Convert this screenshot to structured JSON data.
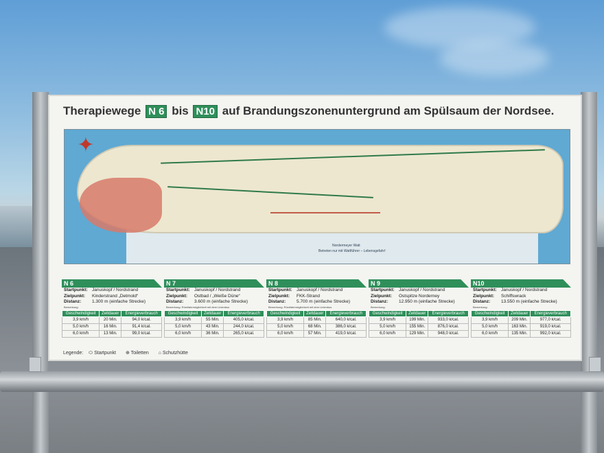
{
  "sign": {
    "title_before": "Therapiewege",
    "tag_start": "N 6",
    "title_mid": "bis",
    "tag_end": "N10",
    "title_after": "auf Brandungszonenuntergrund am Spülsaum der Nordsee."
  },
  "map": {
    "labels": [
      "Nordermeyer Watt",
      "Betreten nur mit Wattführer – Lebensgefahr!"
    ]
  },
  "table_headers": [
    "Geschwindigkeit",
    "Zeitdauer",
    "Energieverbrauch"
  ],
  "field_labels": {
    "start": "Startpunkt:",
    "goal": "Zielpunkt:",
    "distance": "Distanz:",
    "remark": "Bemerkung:"
  },
  "routes": [
    {
      "id": "N 6",
      "start": "Januskopf / Nordstrand",
      "goal": "Kinderstrand „Detmold“",
      "distance": "1.300 m (einfache Strecke)",
      "remark": "Bemerkung:",
      "rows": [
        [
          "3,9 km/h",
          "20 Min.",
          "94,0 k/cal."
        ],
        [
          "5,0 km/h",
          "16 Min.",
          "91,4 k/cal."
        ],
        [
          "6,0 km/h",
          "13 Min.",
          "99,0 k/cal."
        ]
      ]
    },
    {
      "id": "N 7",
      "start": "Januskopf / Nordstrand",
      "goal": "Ostbad / „Weiße Düne“",
      "distance": "3.600 m (einfache Strecke)",
      "remark": "Bemerkung: Rückfahrmöglichkeit mit dem Linienbus",
      "rows": [
        [
          "3,9 km/h",
          "55 Min.",
          "405,0 k/cal."
        ],
        [
          "5,0 km/h",
          "43 Min.",
          "244,0 k/cal."
        ],
        [
          "6,0 km/h",
          "36 Min.",
          "265,0 k/cal."
        ]
      ]
    },
    {
      "id": "N 8",
      "start": "Januskopf / Nordstrand",
      "goal": "FKK-Strand",
      "distance": "5.700 m (einfache Strecke)",
      "remark": "Bemerkung: Rückfahrmöglichkeit mit dem Linienbus",
      "rows": [
        [
          "3,9 km/h",
          "85 Min.",
          "640,0 k/cal."
        ],
        [
          "5,0 km/h",
          "68 Min.",
          "386,0 k/cal."
        ],
        [
          "6,0 km/h",
          "57 Min.",
          "419,0 k/cal."
        ]
      ]
    },
    {
      "id": "N 9",
      "start": "Januskopf / Nordstrand",
      "goal": "Ostspitze Norderney",
      "distance": "12.950 m (einfache Strecke)",
      "remark": "Bemerkung:",
      "rows": [
        [
          "3,9 km/h",
          "199 Min.",
          "933,0 k/cal."
        ],
        [
          "5,0 km/h",
          "155 Min.",
          "876,0 k/cal."
        ],
        [
          "6,0 km/h",
          "129 Min.",
          "948,0 k/cal."
        ]
      ]
    },
    {
      "id": "N10",
      "start": "Januskopf / Nordstrand",
      "goal": "Schiffswrack",
      "distance": "13.550 m (einfache Strecke)",
      "remark": "Bemerkung:",
      "rows": [
        [
          "3,9 km/h",
          "209 Min.",
          "977,0 k/cal."
        ],
        [
          "5,0 km/h",
          "163 Min.",
          "919,0 k/cal."
        ],
        [
          "6,0 km/h",
          "135 Min.",
          "992,0 k/cal."
        ]
      ]
    }
  ],
  "legend": {
    "label": "Legende:",
    "items": [
      "Startpunkt",
      "Toiletten",
      "Schutzhütte"
    ]
  },
  "colors": {
    "sign_green": "#2f8f5a",
    "sea": "#5fa9d3",
    "island": "#ede7cf",
    "town": "#d77a6a"
  }
}
